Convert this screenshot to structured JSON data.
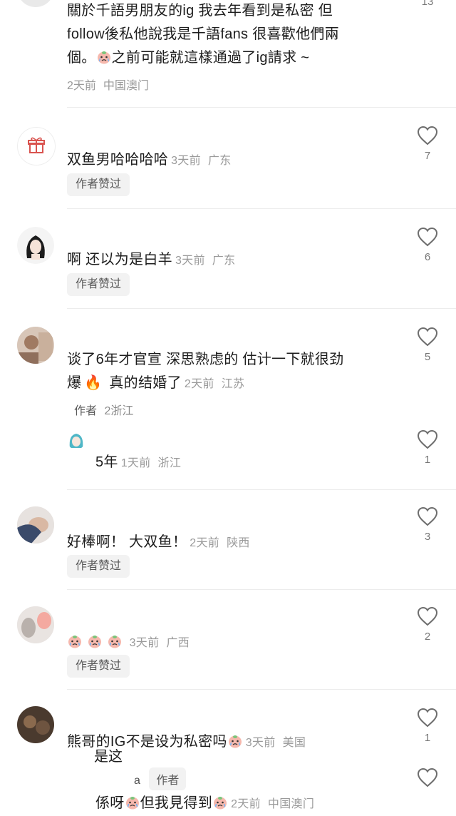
{
  "comments": [
    {
      "text_lines": [
        "關於千語男朋友的ig 我去年看到是私密 但",
        "follow後私他說我是千語fans  很喜歡他們兩",
        "個。"
      ],
      "text_tail": "之前可能就這樣通過了ig請求 ~",
      "time": "2天前",
      "location": "中国澳门",
      "likes": "13"
    },
    {
      "text": "双鱼男哈哈哈哈",
      "time": "3天前",
      "location": "广东",
      "badge": "作者赞过",
      "likes": "7"
    },
    {
      "text": "啊 还以为是白羊",
      "time": "3天前",
      "location": "广东",
      "badge": "作者赞过",
      "likes": "6"
    },
    {
      "text_lines": [
        "谈了6年才官宣 深思熟虑的 估计一下就很劲"
      ],
      "text_prefix2": "爆",
      "text_tail2": " 真的结婚了",
      "time": "2天前",
      "location": "江苏",
      "badge_partial": "作者",
      "badge_overlay": "2浙江",
      "likes": "5"
    },
    {
      "reply": true,
      "text": "5年",
      "time": "1天前",
      "location": "浙江",
      "likes": "1"
    },
    {
      "text": "好棒啊！ 大双鱼！",
      "time": "2天前",
      "location": "陕西",
      "badge": "作者赞过",
      "likes": "3"
    },
    {
      "text": "",
      "time": "3天前",
      "location": "广西",
      "badge": "作者赞过",
      "likes": "2"
    },
    {
      "text": "熊哥的IG不是设为私密吗",
      "overlay": "是这",
      "time": "3天前",
      "location": "美国",
      "likes": "1"
    },
    {
      "reply": true,
      "reply_to": "a",
      "reply_tag": "作者",
      "text_start": "係呀",
      "text_mid": "但我見得到",
      "time": "2天前",
      "location": "中国澳门"
    }
  ],
  "colors": {
    "text": "#1d1d1d",
    "meta": "#9a9a9a",
    "badge_bg": "#f2f2f2",
    "divider": "#ececec",
    "heart_stroke": "#6e6e6e"
  }
}
